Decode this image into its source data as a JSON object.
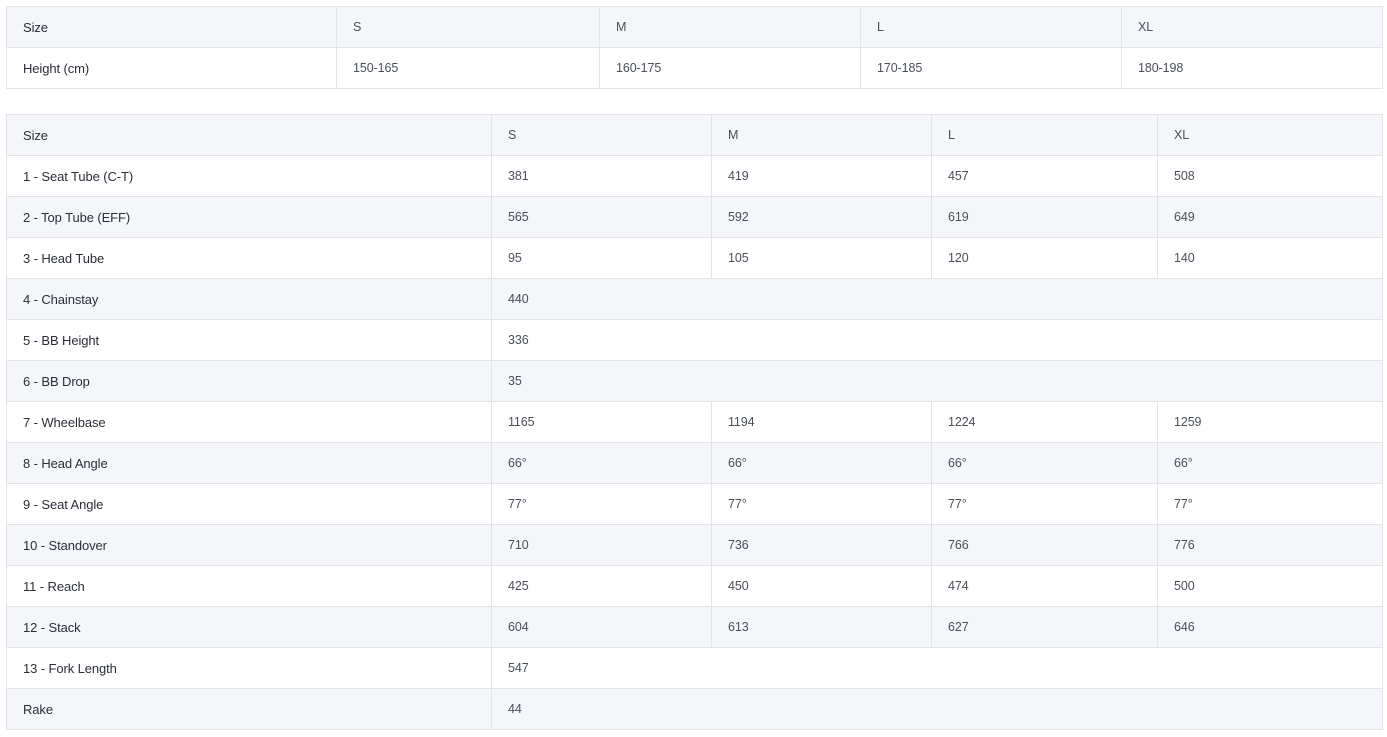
{
  "size_table": {
    "header": [
      "Size",
      "S",
      "M",
      "L",
      "XL"
    ],
    "rows": [
      [
        "Height (cm)",
        "150-165",
        "160-175",
        "170-185",
        "180-198"
      ]
    ]
  },
  "geometry_table": {
    "header": [
      "Size",
      "S",
      "M",
      "L",
      "XL"
    ],
    "rows": [
      [
        "1 - Seat Tube (C-T)",
        "381",
        "419",
        "457",
        "508"
      ],
      [
        "2 - Top Tube (EFF)",
        "565",
        "592",
        "619",
        "649"
      ],
      [
        "3 - Head Tube",
        "95",
        "105",
        "120",
        "140"
      ],
      [
        "4 - Chainstay",
        "440"
      ],
      [
        "5 - BB Height",
        "336"
      ],
      [
        "6 - BB Drop",
        "35"
      ],
      [
        "7 - Wheelbase",
        "1165",
        "1194",
        "1224",
        "1259"
      ],
      [
        "8 - Head Angle",
        "66°",
        "66°",
        "66°",
        "66°"
      ],
      [
        "9 - Seat Angle",
        "77°",
        "77°",
        "77°",
        "77°"
      ],
      [
        "10 - Standover",
        "710",
        "736",
        "766",
        "776"
      ],
      [
        "11 - Reach",
        "425",
        "450",
        "474",
        "500"
      ],
      [
        "12 - Stack",
        "604",
        "613",
        "627",
        "646"
      ],
      [
        "13 - Fork Length",
        "547"
      ],
      [
        "Rake",
        "44"
      ]
    ]
  }
}
